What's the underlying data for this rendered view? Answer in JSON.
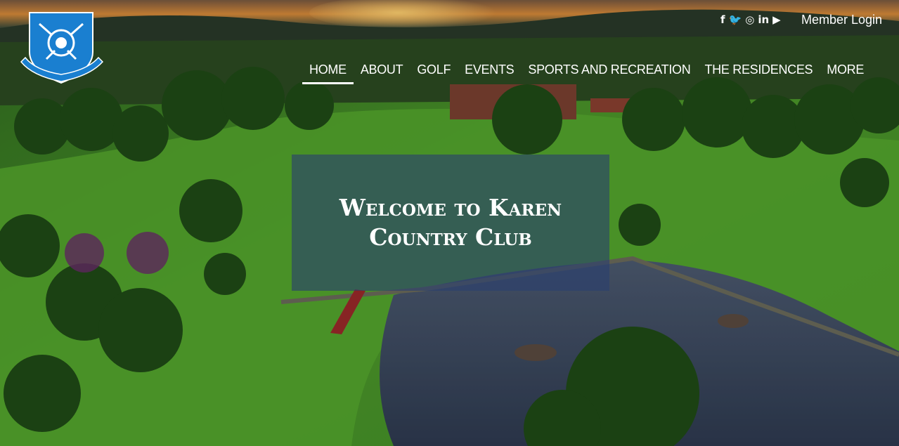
{
  "logo": {
    "alt_text": "Karen Country Club",
    "colors": {
      "shield": "#1a7fd0",
      "trim": "#ffffff"
    }
  },
  "social": [
    {
      "icon": "facebook-icon",
      "glyph": "f"
    },
    {
      "icon": "twitter-icon",
      "glyph": "🐦"
    },
    {
      "icon": "instagram-icon",
      "glyph": "◎"
    },
    {
      "icon": "linkedin-icon",
      "glyph": "in"
    },
    {
      "icon": "youtube-icon",
      "glyph": "▶"
    }
  ],
  "header": {
    "member_login": "Member Login"
  },
  "nav": {
    "items": [
      {
        "label": "HOME",
        "active": true
      },
      {
        "label": "ABOUT",
        "active": false
      },
      {
        "label": "GOLF",
        "active": false
      },
      {
        "label": "EVENTS",
        "active": false
      },
      {
        "label": "SPORTS AND RECREATION",
        "active": false
      },
      {
        "label": "THE RESIDENCES",
        "active": false
      },
      {
        "label": "MORE",
        "active": false
      }
    ]
  },
  "hero": {
    "title_line1": "Welcome to Karen",
    "title_line2": "Country Club",
    "overlay_color": "#2a3f70"
  }
}
